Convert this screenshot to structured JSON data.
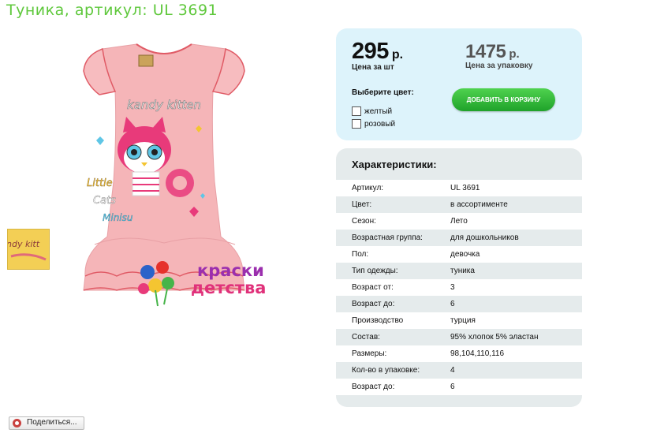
{
  "page": {
    "title": "Туника, артикул: UL 3691"
  },
  "product_image": {
    "print_text_top": "kandy kitten",
    "print_text_left": [
      "Little",
      "Cats",
      "Minisu"
    ],
    "thumb_text": "ndy kitt",
    "brand_logo": [
      "краски",
      "детства"
    ],
    "colors": {
      "shirt": "#f5b5b8",
      "trim": "#e05b66"
    }
  },
  "share": {
    "label": "Поделиться..."
  },
  "price": {
    "unit_value": "295",
    "unit_currency": "р.",
    "unit_caption": "Цена за шт",
    "pack_value": "1475",
    "pack_currency": "р.",
    "pack_caption": "Цена за упаковку",
    "color_title": "Выберите цвет:",
    "color_options": [
      "желтый",
      "розовый"
    ],
    "cart_button": "ДОБАВИТЬ В КОРЗИНУ"
  },
  "specs": {
    "title": "Характеристики:",
    "rows": [
      {
        "k": "Артикул:",
        "v": "UL 3691"
      },
      {
        "k": "Цвет:",
        "v": "в ассортименте"
      },
      {
        "k": "Сезон:",
        "v": "Лето"
      },
      {
        "k": "Возрастная группа:",
        "v": "для дошкольников"
      },
      {
        "k": "Пол:",
        "v": "девочка"
      },
      {
        "k": "Тип одежды:",
        "v": "туника"
      },
      {
        "k": "Возраст от:",
        "v": "3"
      },
      {
        "k": "Возраст до:",
        "v": "6"
      },
      {
        "k": "Производство",
        "v": "турция"
      },
      {
        "k": "Состав:",
        "v": "95% хлопок 5% эластан"
      },
      {
        "k": "Размеры:",
        "v": "98,104,110,116"
      },
      {
        "k": "Кол-во в упаковке:",
        "v": "4"
      },
      {
        "k": "Возраст до:",
        "v": "6"
      }
    ]
  }
}
